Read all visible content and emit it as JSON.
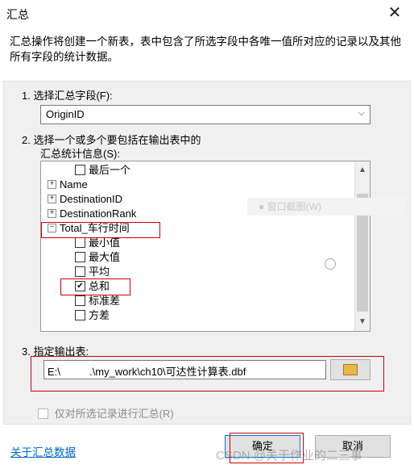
{
  "window": {
    "title": "汇总",
    "close_glyph": "✕"
  },
  "description": "汇总操作将创建一个新表，表中包含了所选字段中各唯一值所对应的记录以及其他所有字段的统计数据。",
  "step1": {
    "label": "1. 选择汇总字段(F):",
    "value": "OriginID"
  },
  "step2": {
    "label_line1": "2. 选择一个或多个要包括在输出表中的",
    "label_line2": "汇总统计信息(S):"
  },
  "tree": [
    {
      "type": "check",
      "label": "最后一个",
      "checked": false,
      "indent": 1
    },
    {
      "type": "node",
      "label": "Name",
      "expanded": false
    },
    {
      "type": "node",
      "label": "DestinationID",
      "expanded": false
    },
    {
      "type": "node",
      "label": "DestinationRank",
      "expanded": false
    },
    {
      "type": "node",
      "label": "Total_车行时间",
      "expanded": true
    },
    {
      "type": "check",
      "label": "最小值",
      "checked": false,
      "indent": 1
    },
    {
      "type": "check",
      "label": "最大值",
      "checked": false,
      "indent": 1
    },
    {
      "type": "check",
      "label": "平均",
      "checked": false,
      "indent": 1
    },
    {
      "type": "check",
      "label": "总和",
      "checked": true,
      "indent": 1
    },
    {
      "type": "check",
      "label": "标准差",
      "checked": false,
      "indent": 1
    },
    {
      "type": "check",
      "label": "方差",
      "checked": false,
      "indent": 1
    }
  ],
  "floating_hint": "窗口截图(W)",
  "step3": {
    "label": "3. 指定输出表:",
    "path": "E:\\          .\\my_work\\ch10\\可达性计算表.dbf"
  },
  "selected_only": {
    "label": "仅对所选记录进行汇总(R)",
    "checked": false,
    "enabled": false
  },
  "footer": {
    "about_link": "关于汇总数据",
    "ok_label": "确定",
    "cancel_label": "取消",
    "watermark": "CSDN @关于作业的二三事"
  },
  "colors": {
    "highlight_box": "#d00000",
    "link": "#0066cc",
    "checkbox_check": "#000000"
  }
}
